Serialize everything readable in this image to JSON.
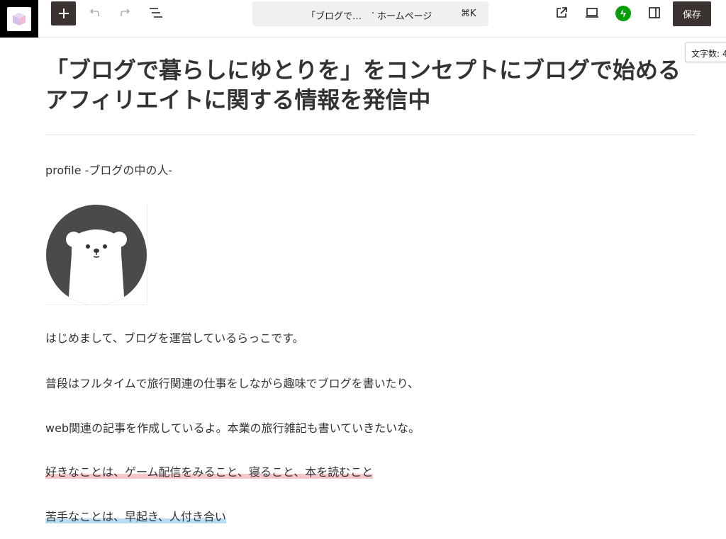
{
  "toolbar": {
    "command_bar": {
      "title": "「ブログで…",
      "separator": "·",
      "template_type": "ホームページ",
      "shortcut": "⌘K"
    },
    "save_label": "保存",
    "word_count_label": "文字数: 4"
  },
  "content": {
    "title": "「ブログで暮らしにゆとりを」をコンセプトにブログで始めるアフィリエイトに関する情報を発信中",
    "profile_heading": "profile -ブログの中の人-",
    "paragraphs": [
      "はじめまして、ブログを運営しているらっこです。",
      "普段はフルタイムで旅行関連の仕事をしながら趣味でブログを書いたり、",
      "web関連の記事を作成しているよ。本業の旅行雑記も書いていきたいな。"
    ],
    "likes": "好きなことは、ゲーム配信をみること、寝ること、本を読むこと",
    "dislikes": "苦手なことは、早起き、人付き合い"
  },
  "colors": {
    "accent_dark": "#3a3331",
    "highlight_pink": "#f5c6cb",
    "highlight_blue": "#b8dcf2",
    "jetpack_green": "#069e08",
    "avatar_dark": "#4a4a4a"
  },
  "icons": {
    "site_logo": "cube-logo-icon",
    "add": "plus-icon",
    "undo": "undo-icon",
    "redo": "redo-icon",
    "document_overview": "list-view-icon",
    "view_external": "external-link-icon",
    "preview": "desktop-preview-icon",
    "jetpack": "jetpack-icon",
    "settings": "sidebar-toggle-icon",
    "avatar": "polar-bear-avatar"
  }
}
